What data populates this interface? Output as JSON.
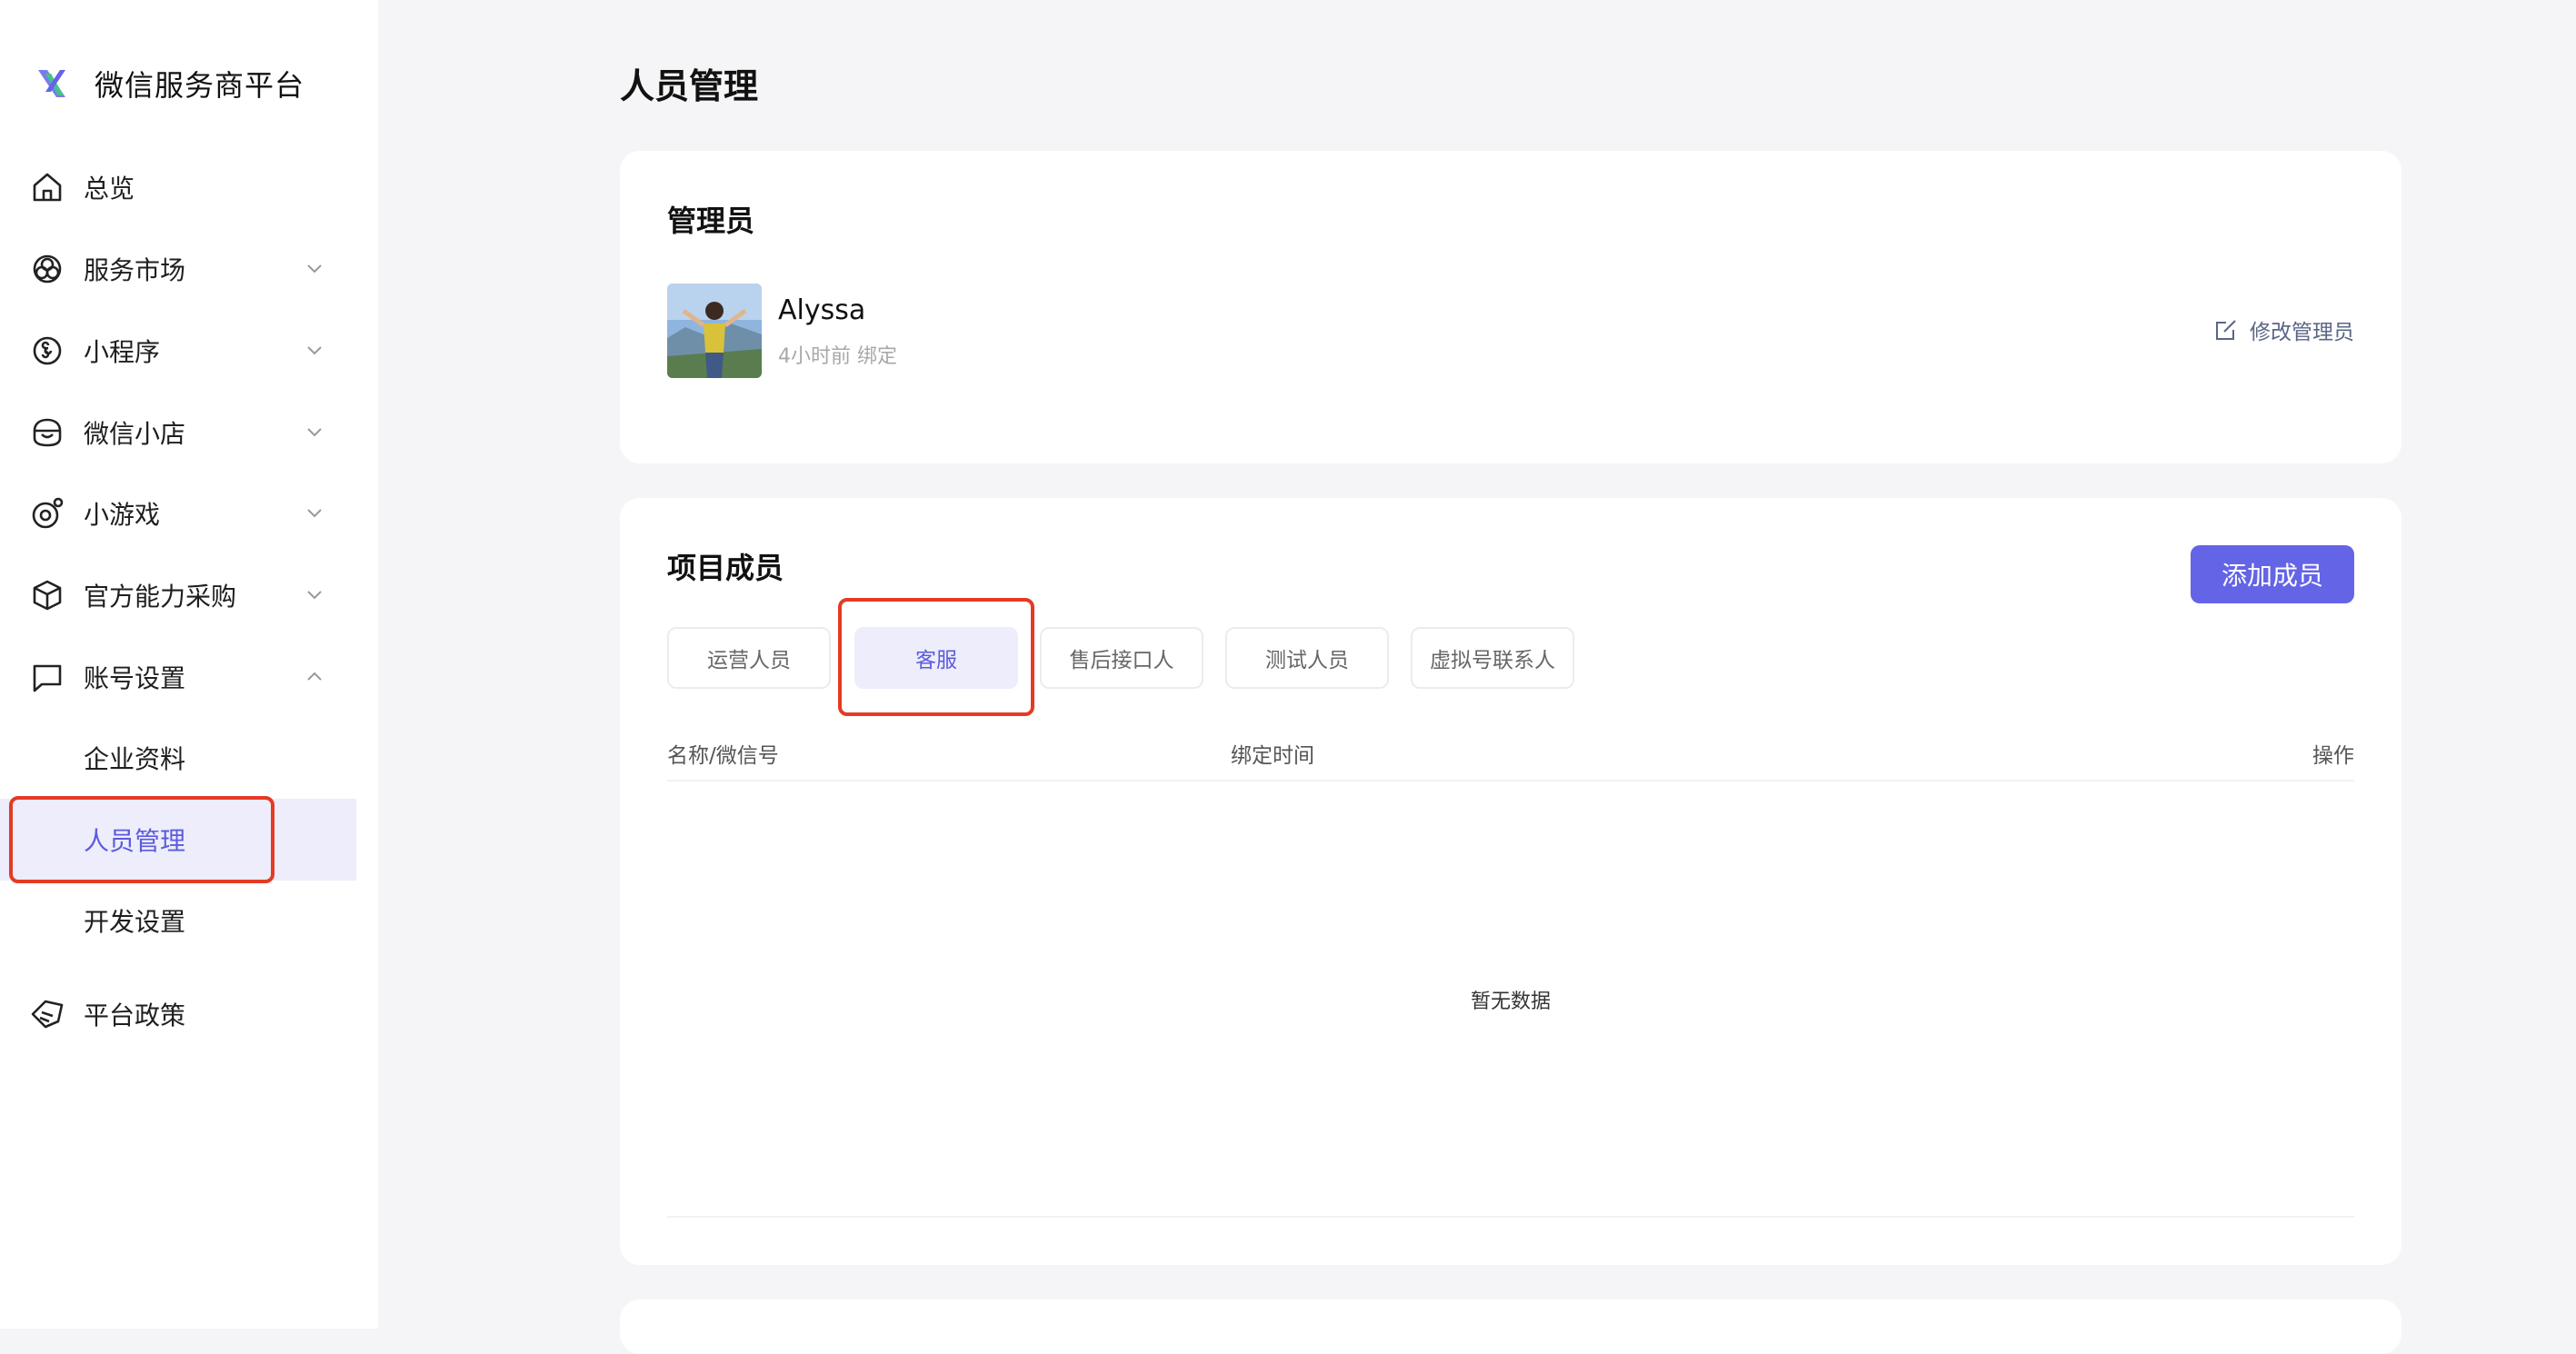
{
  "app": {
    "title": "微信服务商平台",
    "accent": "#6464e6",
    "highlight": "#e53a24"
  },
  "sidebar": {
    "items": [
      {
        "label": "总览",
        "icon": "home-icon"
      },
      {
        "label": "服务市场",
        "icon": "market-icon",
        "expanded": false
      },
      {
        "label": "小程序",
        "icon": "miniprogram-icon",
        "expanded": false
      },
      {
        "label": "微信小店",
        "icon": "shop-icon",
        "expanded": false
      },
      {
        "label": "小游戏",
        "icon": "game-icon",
        "expanded": false
      },
      {
        "label": "官方能力采购",
        "icon": "box-icon",
        "expanded": false
      },
      {
        "label": "账号设置",
        "icon": "chat-icon",
        "expanded": true
      },
      {
        "label": "平台政策",
        "icon": "policy-icon"
      }
    ],
    "account_sub": [
      {
        "label": "企业资料"
      },
      {
        "label": "人员管理",
        "active": true
      },
      {
        "label": "开发设置"
      }
    ]
  },
  "main": {
    "page_title": "人员管理",
    "admin_card": {
      "title": "管理员",
      "name": "Alyssa",
      "bound": "4小时前 绑定",
      "edit_label": "修改管理员"
    },
    "members_card": {
      "title": "项目成员",
      "add_label": "添加成员",
      "tabs": [
        {
          "label": "运营人员"
        },
        {
          "label": "客服",
          "active": true
        },
        {
          "label": "售后接口人"
        },
        {
          "label": "测试人员"
        },
        {
          "label": "虚拟号联系人"
        }
      ],
      "columns": [
        "名称/微信号",
        "绑定时间",
        "操作"
      ],
      "empty_text": "暂无数据"
    }
  }
}
